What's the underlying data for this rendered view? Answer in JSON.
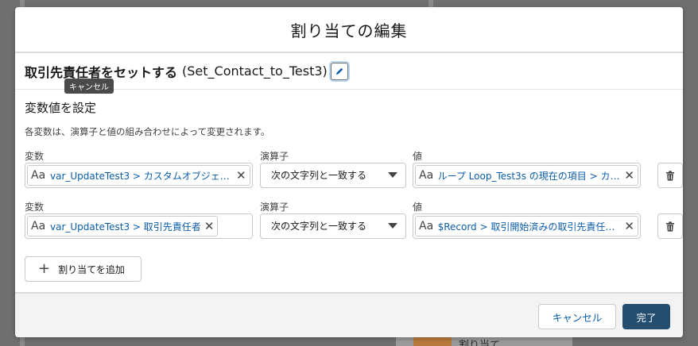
{
  "background": {
    "card_label": "割り当て"
  },
  "modal": {
    "title": "割り当ての編集"
  },
  "element": {
    "name": "取引先責任者をセットする",
    "api_name": "(Set_Contact_to_Test3)",
    "edit_icon": "pencil-icon",
    "tooltip": "キャンセル"
  },
  "section": {
    "subtitle": "変数値を設定",
    "help": "各変数は、演算子と値の組み合わせによって変更されます。"
  },
  "labels": {
    "variable": "変数",
    "operator": "演算子",
    "value": "値"
  },
  "rows": [
    {
      "variable": "var_UpdateTest3 > カスタムオブジェ…",
      "operator": "次の文字列と一致する",
      "value": "ループ Loop_Test3s の現在の項目 > カ…"
    },
    {
      "variable": "var_UpdateTest3 > 取引先責任者",
      "operator": "次の文字列と一致する",
      "value": "$Record > 取引開始済みの取引先責任…"
    }
  ],
  "resource_icon_text": "Aa",
  "remove_glyph": "✕",
  "add_button": "割り当てを追加",
  "footer": {
    "cancel": "キャンセル",
    "done": "完了"
  },
  "colors": {
    "brand": "#234e70",
    "link": "#0b5cab"
  }
}
